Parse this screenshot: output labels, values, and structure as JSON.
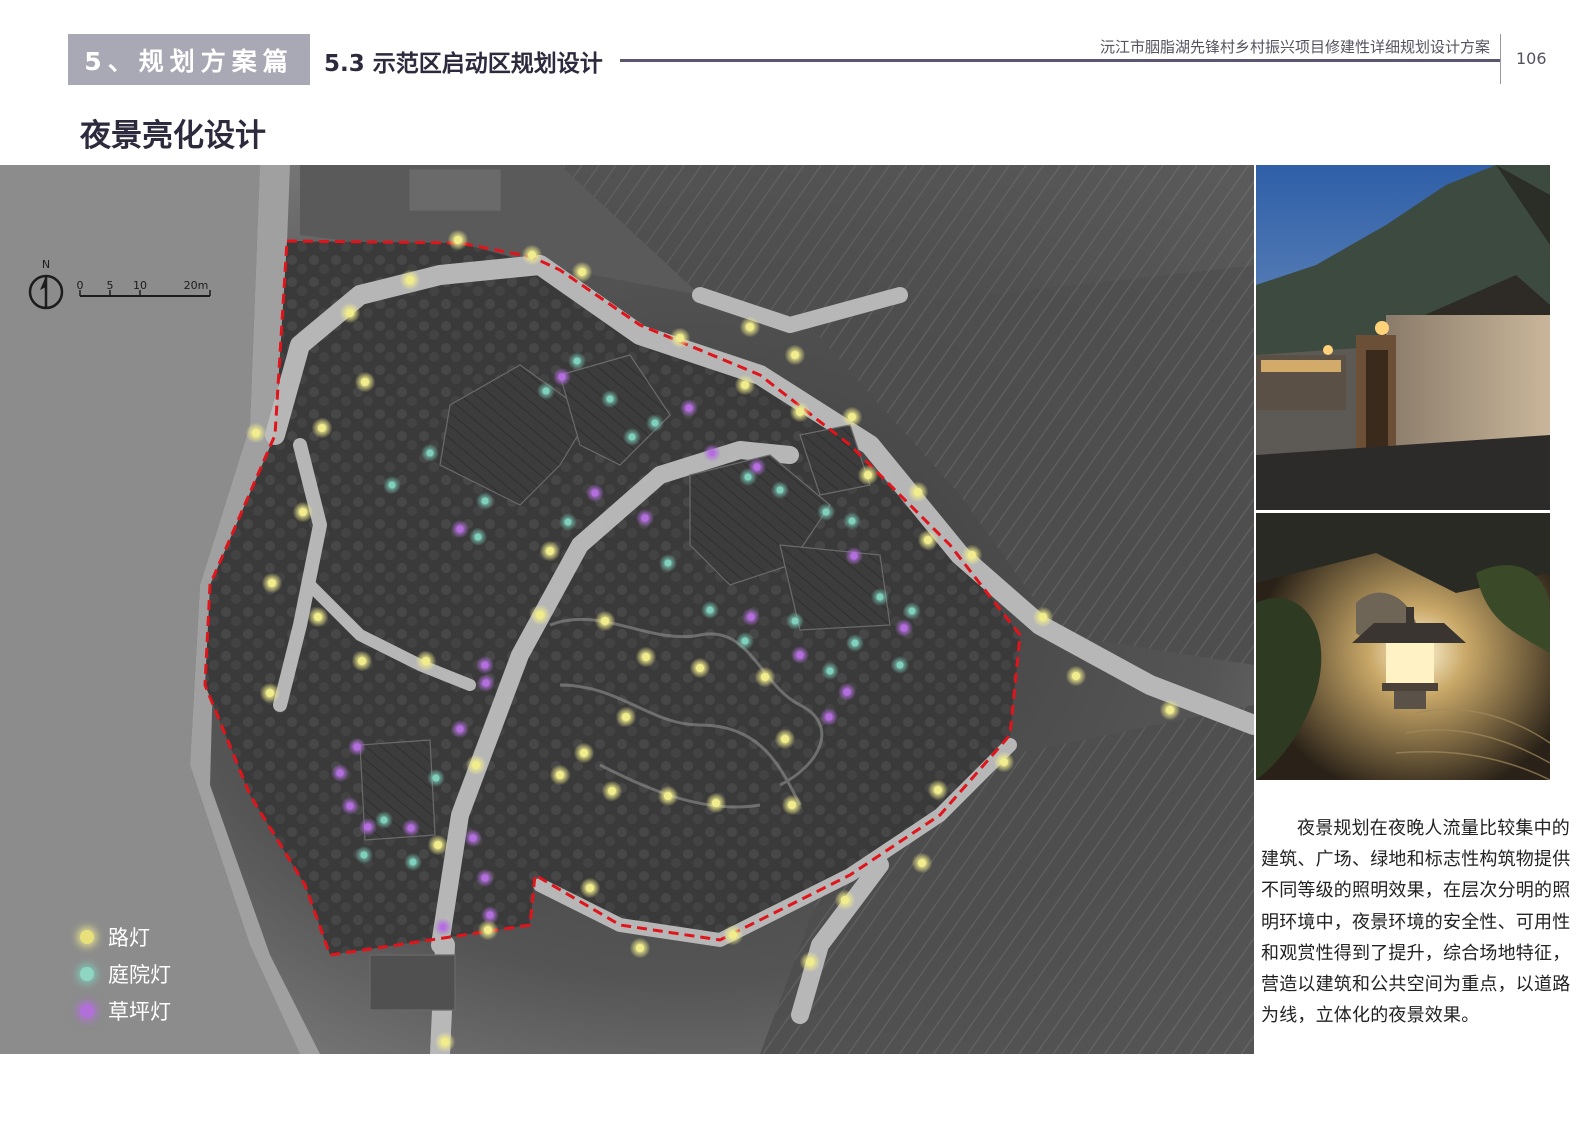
{
  "header": {
    "section_tab": "5、规划方案篇",
    "subsection": "5.3 示范区启动区规划设计",
    "project_title": "沅江市胭脂湖先锋村乡村振兴项目修建性详细规划设计方案",
    "page_number": "106"
  },
  "page_heading": "夜景亮化设计",
  "scale_bar": {
    "north": "N",
    "ticks": [
      "0",
      "5",
      "10",
      "20m"
    ]
  },
  "legend": [
    {
      "label": "路灯",
      "color": "#e8e07a"
    },
    {
      "label": "庭院灯",
      "color": "#8fd6c2"
    },
    {
      "label": "草坪灯",
      "color": "#b070d8"
    }
  ],
  "colors": {
    "boundary": "#e0141a",
    "street_light": "#f1ec8c",
    "garden_light": "#7fd1bd",
    "lawn_light": "#b46ee0"
  },
  "description": "夜景规划在夜晚人流量比较集中的建筑、广场、绿地和标志性构筑物提供不同等级的照明效果，在层次分明的照明环境中，夜景环境的安全性、可用性和观赏性得到了提升，综合场地特征，营造以建筑和公共空间为重点，以道路为线，立体化的夜景效果。"
}
